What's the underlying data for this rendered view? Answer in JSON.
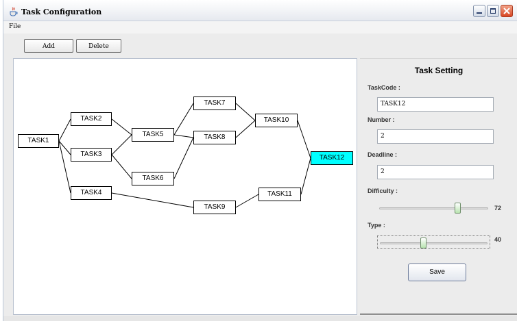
{
  "window": {
    "title": "Task Configuration",
    "app_icon": "java-cup-icon"
  },
  "menu": {
    "file_label": "File"
  },
  "toolbar": {
    "add_label": "Add",
    "delete_label": "Delete"
  },
  "graph": {
    "selected": "TASK12",
    "selected_color": "#00ffff",
    "nodes": {
      "task1": "TASK1",
      "task2": "TASK2",
      "task3": "TASK3",
      "task4": "TASK4",
      "task5": "TASK5",
      "task6": "TASK6",
      "task7": "TASK7",
      "task8": "TASK8",
      "task9": "TASK9",
      "task10": "TASK10",
      "task11": "TASK11",
      "task12": "TASK12"
    },
    "edges": [
      [
        "task1",
        "task2"
      ],
      [
        "task1",
        "task3"
      ],
      [
        "task1",
        "task4"
      ],
      [
        "task2",
        "task5"
      ],
      [
        "task3",
        "task5"
      ],
      [
        "task3",
        "task6"
      ],
      [
        "task5",
        "task7"
      ],
      [
        "task5",
        "task8"
      ],
      [
        "task6",
        "task8"
      ],
      [
        "task7",
        "task10"
      ],
      [
        "task8",
        "task10"
      ],
      [
        "task10",
        "task12"
      ],
      [
        "task4",
        "task9"
      ],
      [
        "task9",
        "task11"
      ],
      [
        "task11",
        "task12"
      ]
    ]
  },
  "panel": {
    "title": "Task Setting",
    "taskcode_label": "TaskCode :",
    "taskcode_value": "TASK12",
    "number_label": "Number :",
    "number_value": "2",
    "deadline_label": "Deadline :",
    "deadline_value": "2",
    "difficulty_label": "Difficulty :",
    "difficulty_value": 72,
    "difficulty_text": "72",
    "type_label": "Type :",
    "type_value": 40,
    "type_text": "40",
    "save_label": "Save"
  }
}
